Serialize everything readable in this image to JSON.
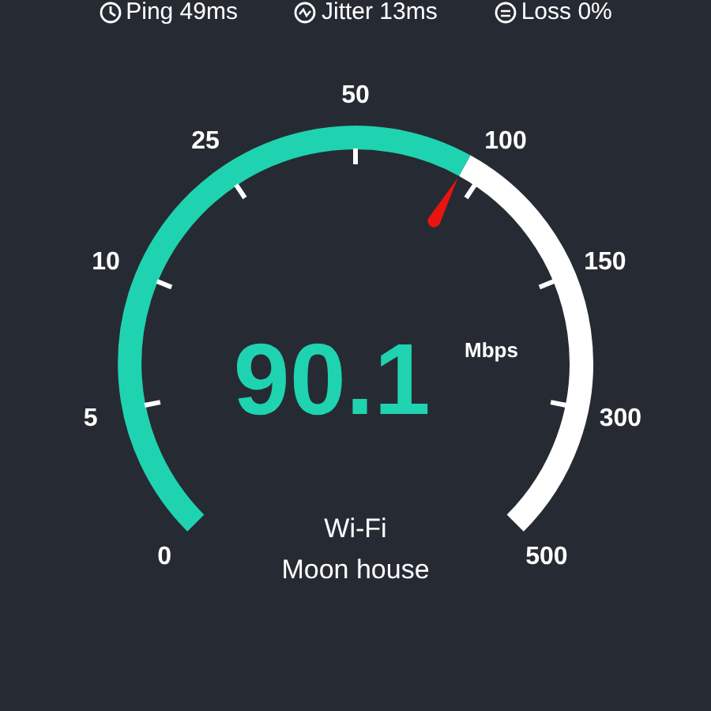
{
  "stats": [
    {
      "kind": "ping",
      "label": "Ping 49ms"
    },
    {
      "kind": "jitter",
      "label": "Jitter 13ms"
    },
    {
      "kind": "loss",
      "label": "Loss 0%"
    }
  ],
  "gauge": {
    "scale": [
      "0",
      "5",
      "10",
      "25",
      "50",
      "100",
      "150",
      "300",
      "500"
    ],
    "speed": "90.1",
    "unit": "Mbps",
    "network": "Wi-Fi",
    "network_name": "Moon house"
  }
}
